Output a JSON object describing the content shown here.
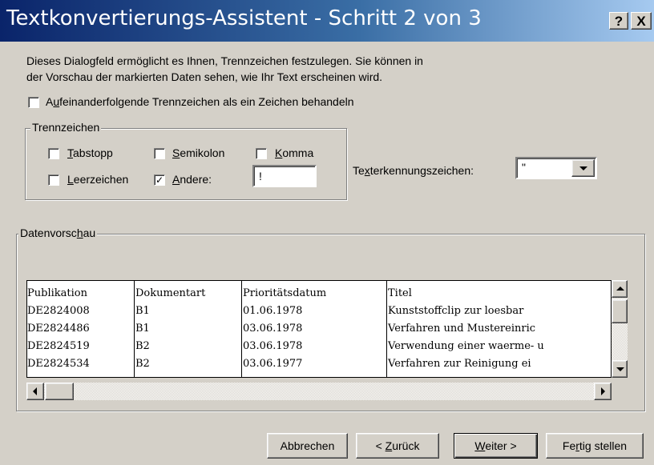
{
  "window": {
    "title": "Textkonvertierungs-Assistent - Schritt 2 von 3",
    "help_label": "?",
    "close_label": "X"
  },
  "intro": {
    "line1": "Dieses Dialogfeld ermöglicht es Ihnen, Trennzeichen festzulegen. Sie können in",
    "line2": "der Vorschau der markierten Daten sehen, wie Ihr Text erscheinen wird."
  },
  "consecutive": {
    "label_pre": "A",
    "label_accel": "u",
    "label_post": "feinanderfolgende Trennzeichen als ein Zeichen behandeln",
    "checked": false
  },
  "delimiters": {
    "group_label": "Trennzeichen",
    "tab": {
      "accel": "T",
      "rest": "abstopp",
      "checked": false
    },
    "semicolon": {
      "accel": "S",
      "rest": "emikolon",
      "checked": false
    },
    "comma": {
      "accel": "K",
      "rest": "omma",
      "checked": false
    },
    "space": {
      "accel": "L",
      "rest": "eerzeichen",
      "checked": false
    },
    "other": {
      "accel": "A",
      "rest": "ndere:",
      "checked": true,
      "check_glyph": "✓"
    },
    "other_value": "!"
  },
  "qualifier": {
    "label_pre": "Te",
    "label_accel": "x",
    "label_post": "terkennungszeichen:",
    "value": "\""
  },
  "preview": {
    "group_label_pre": "Datenvorsc",
    "group_label_accel": "h",
    "group_label_post": "au",
    "columns": [
      "Publikation",
      "Dokumentart",
      "Prioritätsdatum",
      "Titel"
    ],
    "rows": [
      [
        "DE2824008",
        "B1",
        "01.06.1978",
        "Kunststoffclip zur loesbar"
      ],
      [
        "DE2824486",
        "B1",
        "03.06.1978",
        "Verfahren und Mustereinric"
      ],
      [
        "DE2824519",
        "B2",
        "03.06.1978",
        "Verwendung einer waerme- u"
      ],
      [
        "DE2824534",
        "B2",
        "03.06.1977",
        "Verfahren zur Reinigung ei"
      ]
    ]
  },
  "buttons": {
    "cancel": "Abbrechen",
    "back_pre": "< ",
    "back_accel": "Z",
    "back_post": "urück",
    "next_accel": "W",
    "next_post": "eiter >",
    "finish_pre": "Fe",
    "finish_accel": "r",
    "finish_post": "tig stellen"
  }
}
